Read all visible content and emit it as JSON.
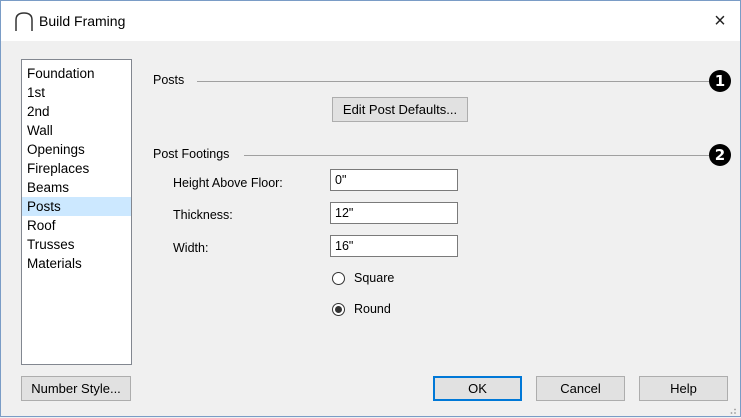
{
  "window": {
    "title": "Build Framing",
    "close_glyph": "×",
    "icon": "framing-arc-icon"
  },
  "categories": [
    {
      "label": "Foundation",
      "selected": false
    },
    {
      "label": "1st",
      "selected": false
    },
    {
      "label": "2nd",
      "selected": false
    },
    {
      "label": "Wall",
      "selected": false
    },
    {
      "label": "Openings",
      "selected": false
    },
    {
      "label": "Fireplaces",
      "selected": false
    },
    {
      "label": "Beams",
      "selected": false
    },
    {
      "label": "Posts",
      "selected": true
    },
    {
      "label": "Roof",
      "selected": false
    },
    {
      "label": "Trusses",
      "selected": false
    },
    {
      "label": "Materials",
      "selected": false
    }
  ],
  "posts": {
    "group_label": "Posts",
    "marker": "1",
    "edit_defaults_label": "Edit Post Defaults..."
  },
  "footings": {
    "group_label": "Post Footings",
    "marker": "2",
    "height_label": "Height Above Floor:",
    "height_value": "0\"",
    "thickness_label": "Thickness:",
    "thickness_value": "12\"",
    "width_label": "Width:",
    "width_value": "16\"",
    "shape_options": [
      {
        "label": "Square",
        "checked": false
      },
      {
        "label": "Round",
        "checked": true
      }
    ]
  },
  "footer": {
    "number_style_label": "Number Style...",
    "ok_label": "OK",
    "cancel_label": "Cancel",
    "help_label": "Help"
  },
  "colors": {
    "selection": "#cce8ff",
    "default_button_border": "#0078d7",
    "dialog_bg": "#f0f0f0"
  }
}
